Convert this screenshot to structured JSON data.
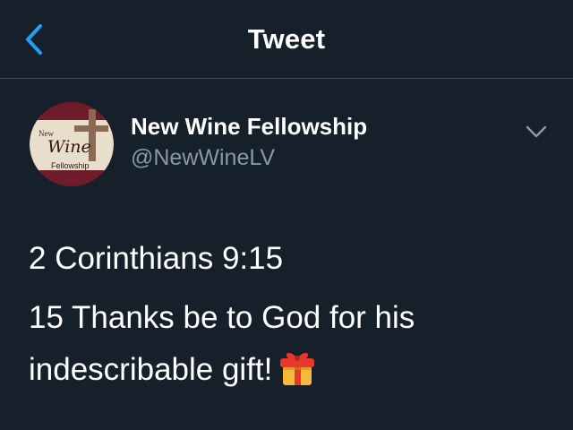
{
  "nav": {
    "title": "Tweet",
    "back_icon": "chevron-left-icon"
  },
  "tweet": {
    "author": {
      "name": "New Wine Fellowship",
      "handle": "@NewWineLV",
      "avatar_text": {
        "top": "New",
        "middle": "Wine",
        "bottom": "Fellowship"
      }
    },
    "more_icon": "chevron-down-icon",
    "lines": [
      "2 Corinthians 9:15",
      "15 Thanks be to God for his indescribable gift!"
    ],
    "emoji": "gift-icon"
  },
  "colors": {
    "background": "#15202b",
    "accent": "#1da1f2",
    "secondary_text": "#8899a6",
    "divider": "#3d4a57"
  }
}
